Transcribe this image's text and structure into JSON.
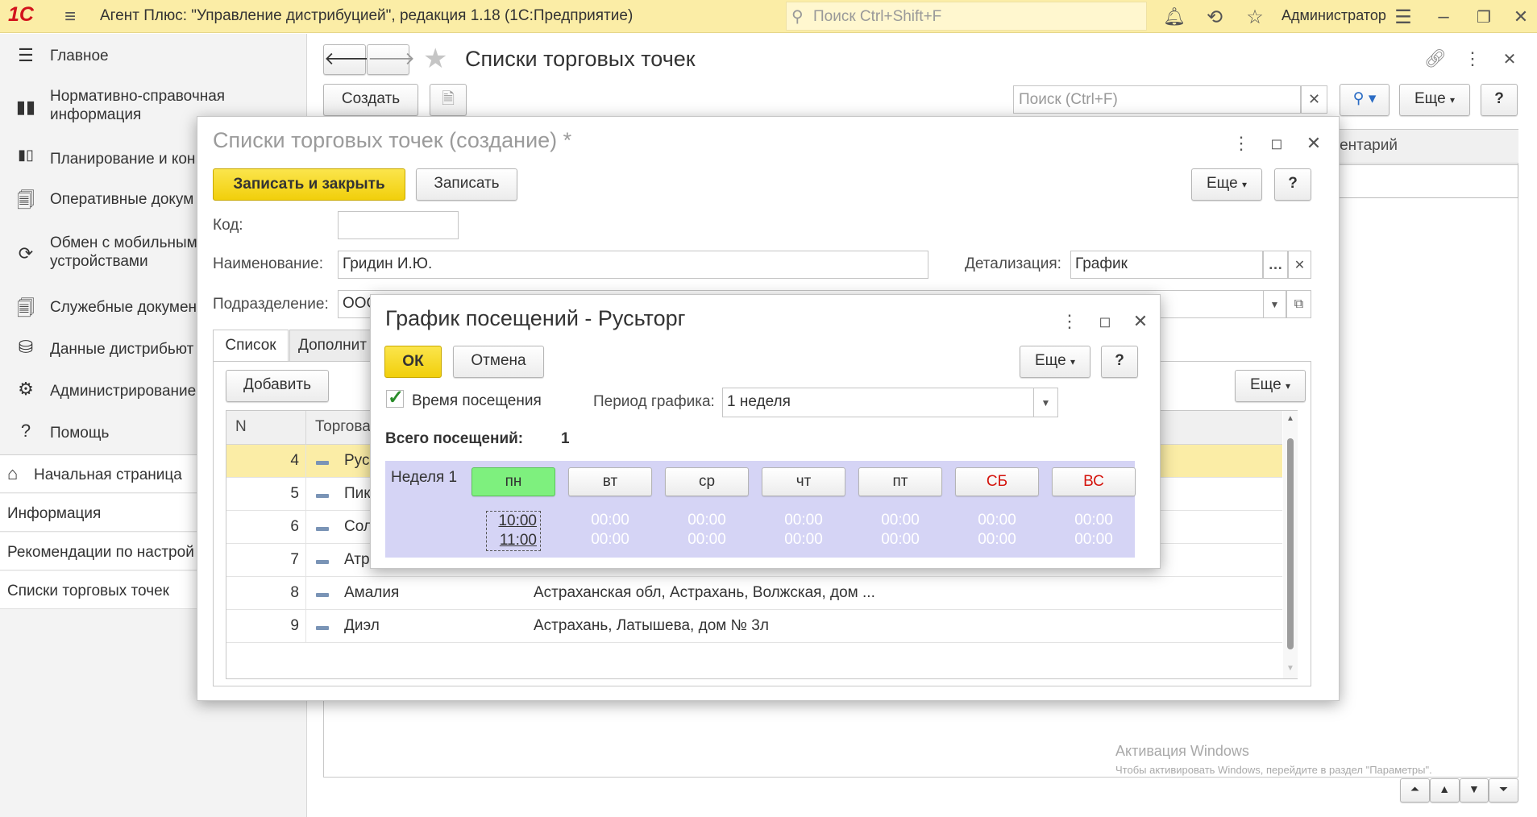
{
  "app": {
    "logo": "1С",
    "title": "Агент Плюс: \"Управление дистрибуцией\", редакция 1.18  (1С:Предприятие)",
    "search_placeholder": "Поиск Ctrl+Shift+F",
    "user": "Администратор"
  },
  "sidebar": {
    "sections": [
      {
        "label": "Главное",
        "icon": "menu-lines-icon"
      },
      {
        "label": "Нормативно-справочная информация",
        "icon": "bar-chart-icon"
      },
      {
        "label": "Планирование и кон",
        "icon": "bar-chart-icon"
      },
      {
        "label": "Оперативные докум",
        "icon": "documents-icon"
      },
      {
        "label": "Обмен с мобильным устройствами",
        "icon": "sync-icon"
      },
      {
        "label": "Служебные докумен",
        "icon": "documents-icon"
      },
      {
        "label": "Данные дистрибьют",
        "icon": "coins-icon"
      },
      {
        "label": "Администрирование",
        "icon": "gear-icon"
      },
      {
        "label": "Помощь",
        "icon": "question-icon"
      }
    ],
    "pages": [
      {
        "label": "Начальная страница",
        "icon": "home-icon"
      },
      {
        "label": "Информация"
      },
      {
        "label": "Рекомендации по настрой"
      },
      {
        "label": "Списки торговых точек"
      }
    ]
  },
  "main": {
    "title": "Списки торговых точек",
    "create_label": "Создать",
    "search_placeholder": "Поиск (Ctrl+F)",
    "more_label": "Еще",
    "help_label": "?",
    "column_partial": "ментарий",
    "watermark_title": "Активация Windows",
    "watermark_text": "Чтобы активировать Windows, перейдите в раздел \"Параметры\"."
  },
  "form": {
    "title": "Списки торговых точек (создание) *",
    "save_close_label": "Записать и закрыть",
    "save_label": "Записать",
    "more_label": "Еще",
    "help_label": "?",
    "code_label": "Код:",
    "code_value": "",
    "name_label": "Наименование:",
    "name_value": "Гридин И.Ю.",
    "detail_label": "Детализация:",
    "detail_value": "График",
    "division_label": "Подразделение:",
    "division_value": "ООО",
    "tabs": [
      "Список",
      "Дополнит"
    ],
    "add_label": "Добавить",
    "table_more_label": "Еще",
    "columns": {
      "n": "N",
      "outlet": "Торгова"
    },
    "rows": [
      {
        "n": "4",
        "name": "Рус",
        "address": ""
      },
      {
        "n": "5",
        "name": "Пик",
        "address": ""
      },
      {
        "n": "6",
        "name": "Сол",
        "address": ""
      },
      {
        "n": "7",
        "name": "Атр",
        "address": ""
      },
      {
        "n": "8",
        "name": "Амалия",
        "address": "Астраханская обл, Астрахань, Волжская, дом ..."
      },
      {
        "n": "9",
        "name": "Диэл",
        "address": "Астрахань, Латышева, дом № 3л"
      }
    ]
  },
  "schedule": {
    "title": "График посещений - Русьторг",
    "ok_label": "ОК",
    "cancel_label": "Отмена",
    "more_label": "Еще",
    "help_label": "?",
    "visit_time_label": "Время посещения",
    "visit_time_checked": true,
    "period_label": "Период графика:",
    "period_value": "1 неделя",
    "total_label": "Всего посещений:",
    "total_value": "1",
    "week_label": "Неделя 1",
    "days": [
      {
        "label": "пн",
        "from": "10:00",
        "to": "11:00",
        "selected": true,
        "weekend": false
      },
      {
        "label": "вт",
        "from": "00:00",
        "to": "00:00",
        "selected": false,
        "weekend": false
      },
      {
        "label": "ср",
        "from": "00:00",
        "to": "00:00",
        "selected": false,
        "weekend": false
      },
      {
        "label": "чт",
        "from": "00:00",
        "to": "00:00",
        "selected": false,
        "weekend": false
      },
      {
        "label": "пт",
        "from": "00:00",
        "to": "00:00",
        "selected": false,
        "weekend": false
      },
      {
        "label": "СБ",
        "from": "00:00",
        "to": "00:00",
        "selected": false,
        "weekend": true
      },
      {
        "label": "ВС",
        "from": "00:00",
        "to": "00:00",
        "selected": false,
        "weekend": true
      }
    ]
  },
  "colors": {
    "topbar": "#fbeda6",
    "accent_yellow": "#f5d80e",
    "selected_day": "#7ef07e",
    "schedule_bg": "#d5d4f5",
    "weekend_red": "#d4130c"
  }
}
